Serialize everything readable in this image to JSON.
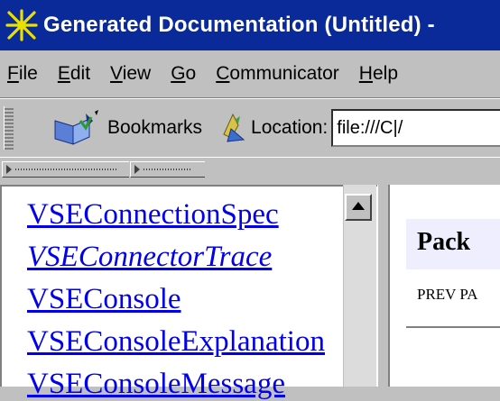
{
  "window": {
    "title": "Generated Documentation (Untitled) -"
  },
  "menubar": {
    "items": [
      {
        "mnemonic": "F",
        "rest": "ile"
      },
      {
        "mnemonic": "E",
        "rest": "dit"
      },
      {
        "mnemonic": "V",
        "rest": "iew"
      },
      {
        "mnemonic": "G",
        "rest": "o"
      },
      {
        "mnemonic": "C",
        "rest": "ommunicator"
      },
      {
        "mnemonic": "H",
        "rest": "elp"
      }
    ]
  },
  "toolbar": {
    "bookmarks_label": "Bookmarks",
    "location_label": "Location:",
    "location_value": "file:///C|/"
  },
  "left_frame": {
    "class_links": [
      "VSEConnectionSpec",
      "VSEConnectorTrace",
      "VSEConsole",
      "VSEConsoleExplanation",
      "VSEConsoleMessage"
    ]
  },
  "right_frame": {
    "package_heading": "Pack",
    "prev_link": "PREV PA"
  },
  "colors": {
    "titlebar": "#0a2a9a",
    "link": "#0000ee",
    "chrome": "#c0c0c0",
    "package_box": "#eeeeff"
  }
}
